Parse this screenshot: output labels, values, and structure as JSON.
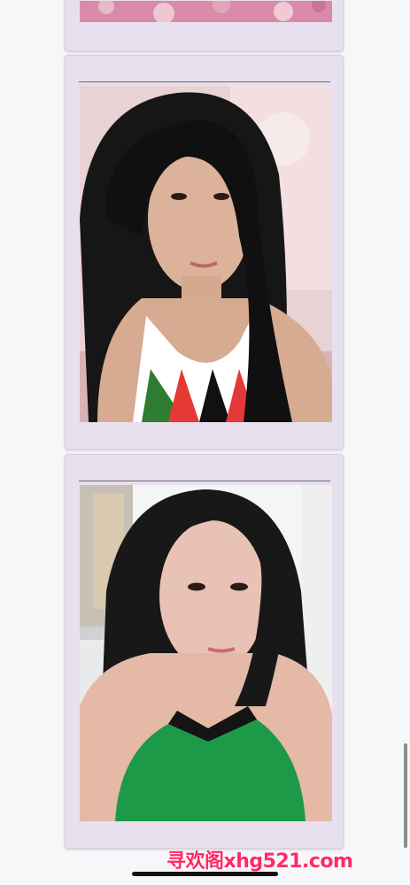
{
  "feed": {
    "cards": [
      {
        "image_desc": "pink-patterned-photo-crop"
      },
      {
        "image_desc": "selfie-woman-knit-halter-top"
      },
      {
        "image_desc": "selfie-woman-green-halter-top"
      }
    ]
  },
  "watermark": {
    "text": "寻欢阁xhg521.com",
    "color": "#ff2a66"
  },
  "colors": {
    "card_bg": "#e8e0ee",
    "page_bg": "#f7f7f9"
  }
}
